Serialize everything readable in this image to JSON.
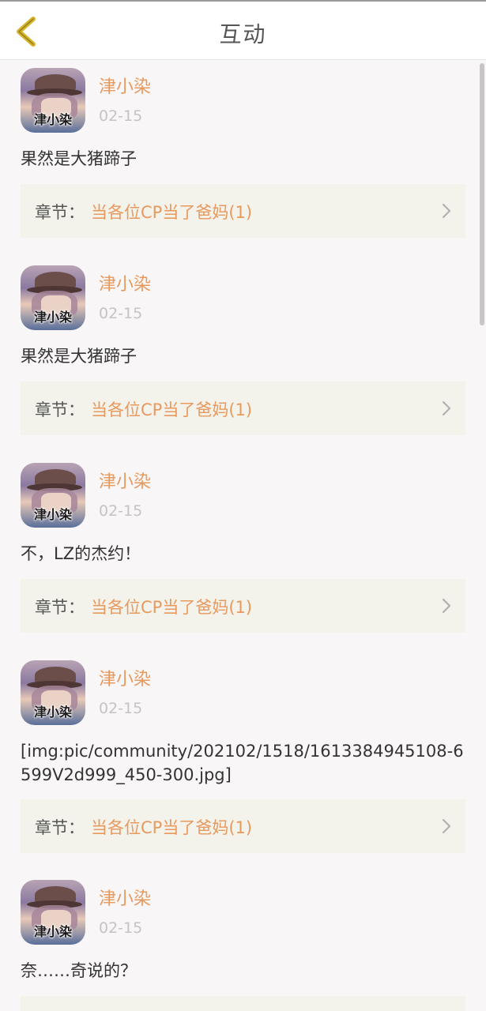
{
  "header": {
    "title": "互动",
    "back_icon": "chevron-left-icon",
    "back_color": "#d4b42a"
  },
  "feed": {
    "items": [
      {
        "avatar_label": "津小染",
        "username": "津小染",
        "date": "02-15",
        "comment": "果然是大猪蹄子",
        "chapter_prefix": "章节：",
        "chapter_title": "当各位CP当了爸妈(1)"
      },
      {
        "avatar_label": "津小染",
        "username": "津小染",
        "date": "02-15",
        "comment": "果然是大猪蹄子",
        "chapter_prefix": "章节：",
        "chapter_title": "当各位CP当了爸妈(1)"
      },
      {
        "avatar_label": "津小染",
        "username": "津小染",
        "date": "02-15",
        "comment": "不，LZ的杰约！",
        "chapter_prefix": "章节：",
        "chapter_title": "当各位CP当了爸妈(1)"
      },
      {
        "avatar_label": "津小染",
        "username": "津小染",
        "date": "02-15",
        "comment": "[img:pic/community/202102/1518/1613384945108-6599V2d999_450-300.jpg]",
        "chapter_prefix": "章节：",
        "chapter_title": "当各位CP当了爸妈(1)"
      },
      {
        "avatar_label": "津小染",
        "username": "津小染",
        "date": "02-15",
        "comment": "奈……奇说的？",
        "chapter_prefix": "",
        "chapter_title": ""
      }
    ]
  },
  "colors": {
    "accent": "#e8995e",
    "chapter_bg": "#f3f3ec",
    "background": "#f8f6f6",
    "date": "#c4c4c4"
  }
}
